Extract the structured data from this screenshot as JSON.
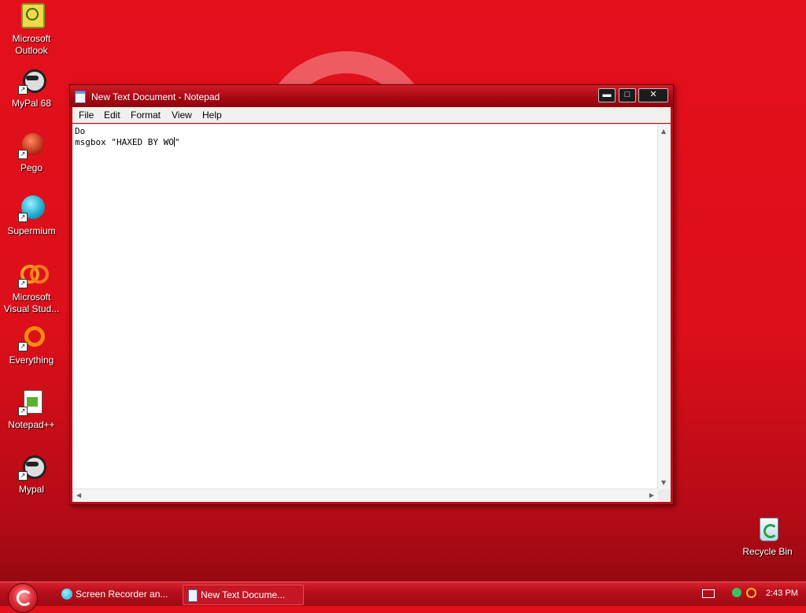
{
  "desktop": {
    "icons": [
      {
        "label": "Microsoft Outlook",
        "icon": "outlook-icon"
      },
      {
        "label": "MyPal 68",
        "icon": "mypal-icon"
      },
      {
        "label": "Pego",
        "icon": "pego-icon"
      },
      {
        "label": "Supermium",
        "icon": "supermium-icon"
      },
      {
        "label": "Microsoft Visual Stud...",
        "icon": "visual-studio-icon"
      },
      {
        "label": "Everything",
        "icon": "everything-icon"
      },
      {
        "label": "Notepad++",
        "icon": "notepadpp-icon"
      },
      {
        "label": "Mypal",
        "icon": "mypal-icon"
      }
    ],
    "recycle_bin": "Recycle Bin"
  },
  "notepad": {
    "title": "New Text Document - Notepad",
    "menu": [
      "File",
      "Edit",
      "Format",
      "View",
      "Help"
    ],
    "controls": {
      "minimize": "▬",
      "maximize": "□",
      "close": "✕"
    },
    "lines": [
      "Do",
      "msgbox \"HAXED BY WO",
      "\""
    ]
  },
  "taskbar": {
    "tasks": [
      {
        "label": "Screen Recorder an...",
        "icon": "screen-recorder-icon",
        "active": false
      },
      {
        "label": "New Text Docume...",
        "icon": "notepad-icon",
        "active": true
      }
    ],
    "clock": "2:43 PM"
  },
  "colors": {
    "desktop": "#e3101c",
    "titlebar": "#a40812",
    "taskbar": "#b70f1b"
  }
}
